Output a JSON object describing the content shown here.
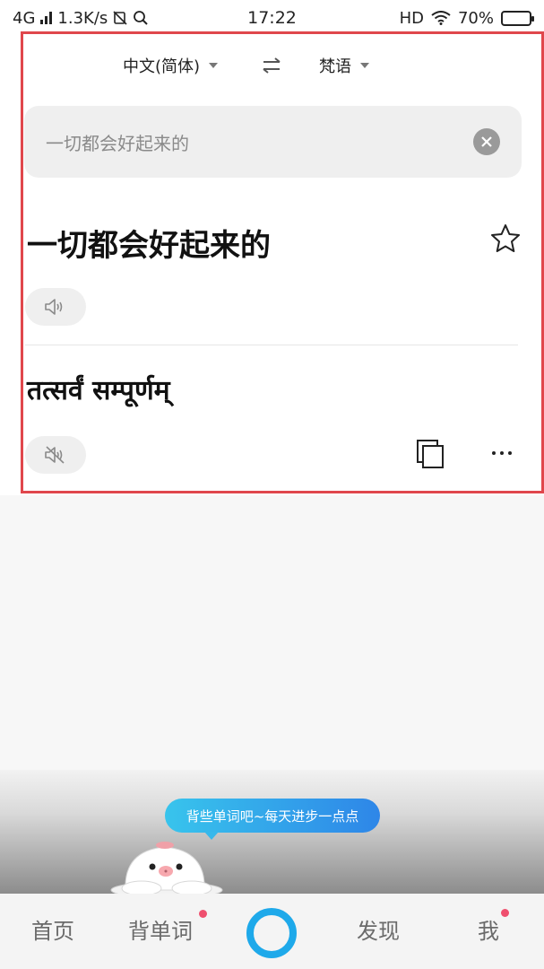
{
  "status_bar": {
    "network": "4G",
    "speed": "1.3K/s",
    "time": "17:22",
    "hd": "HD",
    "battery": "70%",
    "battery_level": 0.7
  },
  "translator": {
    "source_lang": "中文(简体)",
    "target_lang": "梵语",
    "input_text": "一切都会好起来的",
    "source_text": "一切都会好起来的",
    "result_text": "तत्सर्वं सम्पूर्णम्"
  },
  "promo": {
    "bubble_text": "背些单词吧~每天进步一点点"
  },
  "bottom_nav": {
    "home": "首页",
    "vocab": "背单词",
    "discover": "发现",
    "me": "我"
  },
  "colors": {
    "accent": "#1ea9ea",
    "highlight_border": "#e0474c",
    "badge": "#ef4f6e"
  }
}
